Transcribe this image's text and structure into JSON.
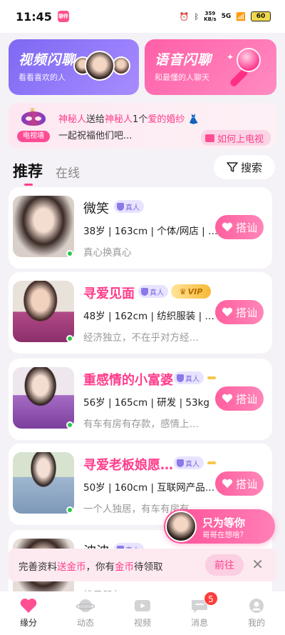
{
  "status_bar": {
    "time": "11:45",
    "app_badge": "聊伴",
    "net_speed_top": "359",
    "net_speed_bottom": "KB/s",
    "signal": "5G",
    "battery": "60"
  },
  "features": {
    "video": {
      "title": "视频闪聊",
      "subtitle": "看看喜欢的人"
    },
    "voice": {
      "title": "语音闪聊",
      "subtitle": "和最懂的人聊天"
    }
  },
  "tv_banner": {
    "tag": "电视墙",
    "sender": "神秘人",
    "send_word": "送给",
    "receiver": "神秘人",
    "count": "1个",
    "gift": "爱的婚纱",
    "line2": "一起祝福他们吧...",
    "howto": "如何上电视"
  },
  "tabs": {
    "recommend": "推荐",
    "online": "在线",
    "search": "搜索"
  },
  "users": [
    {
      "name": "微笑",
      "name_style": "plain",
      "real": "真人",
      "vip": "",
      "info": "38岁 | 163cm | 个体/网店 | 5…",
      "bio": "真心换真心",
      "chat": "搭讪"
    },
    {
      "name": "寻爱见面",
      "name_style": "pink",
      "real": "真人",
      "vip": "VIP",
      "info": "48岁 | 162cm | 纺织服装 | 6…",
      "bio": "经济独立，不在乎对方经…",
      "chat": "搭讪"
    },
    {
      "name": "重感情的小富婆",
      "name_style": "pink",
      "real": "真人",
      "vip": "",
      "info": "56岁 | 165cm | 研发 | 53kg",
      "bio": "有车有房有存款，感情上…",
      "chat": "搭讪"
    },
    {
      "name": "寻爱老板娘愿…",
      "name_style": "pink",
      "real": "真人",
      "vip": "",
      "info": "50岁 | 160cm | 互联网产品…",
      "bio": "一个人独居，有车有房有…",
      "chat": "搭讪"
    },
    {
      "name": "波波",
      "name_style": "plain",
      "real": "真人",
      "vip": "",
      "info": "",
      "bio": "找男朋友",
      "chat": ""
    }
  ],
  "float_bubble": {
    "title": "只为等你",
    "subtitle": "哥哥在想啥?"
  },
  "reward": {
    "prefix": "完善资料",
    "highlight1": "送金币",
    "middle": "，你有",
    "highlight2": "金币",
    "suffix": "待领取",
    "go": "前往"
  },
  "nav": [
    {
      "label": "缘分",
      "icon": "heart-icon",
      "active": true
    },
    {
      "label": "动态",
      "icon": "planet-icon",
      "active": false
    },
    {
      "label": "视频",
      "icon": "video-icon",
      "active": false
    },
    {
      "label": "消息",
      "icon": "message-icon",
      "active": false,
      "badge": "5"
    },
    {
      "label": "我的",
      "icon": "profile-icon",
      "active": false
    }
  ],
  "colors": {
    "accent": "#ff3d8c",
    "video_card": "#7e68f3",
    "voice_card": "#ff5fa7",
    "online": "#2bc84a"
  }
}
